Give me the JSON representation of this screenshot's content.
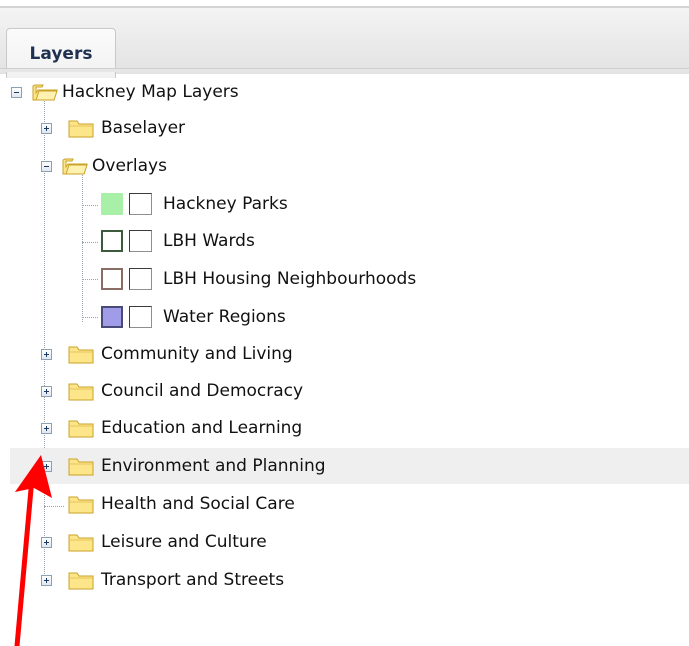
{
  "top_caption": "",
  "tabs": [
    {
      "label": "Layers"
    }
  ],
  "tree": {
    "root": {
      "label": "Hackney Map Layers",
      "expanded": true
    },
    "items": [
      {
        "label": "Baselayer",
        "expanded": false
      },
      {
        "label": "Overlays",
        "expanded": true,
        "children": [
          {
            "label": "Hackney Parks",
            "swatch": {
              "fill": "#a8f0a8",
              "border": "#a8f0a8"
            }
          },
          {
            "label": "LBH Wards",
            "swatch": {
              "fill": "#ffffff",
              "border": "#3d5a3d"
            }
          },
          {
            "label": "LBH Housing Neighbourhoods",
            "swatch": {
              "fill": "#ffffff",
              "border": "#8a6e66"
            }
          },
          {
            "label": "Water Regions",
            "swatch": {
              "fill": "#a09ce8",
              "border": "#4a4a78"
            }
          }
        ]
      },
      {
        "label": "Community and Living",
        "expanded": false
      },
      {
        "label": "Council and Democracy",
        "expanded": false
      },
      {
        "label": "Education and Learning",
        "expanded": false
      },
      {
        "label": "Environment and Planning",
        "expanded": false,
        "highlighted": true
      },
      {
        "label": "Health and Social Care",
        "expanded": false
      },
      {
        "label": "Leisure and Culture",
        "expanded": false
      },
      {
        "label": "Transport and Streets",
        "expanded": false
      }
    ]
  },
  "colors": {
    "annotation_arrow": "#ff0000",
    "folder_fill": "#fde68a",
    "folder_border": "#c9a227",
    "tree_lines": "#9aa3ad",
    "tab_text": "#1f3050",
    "hover_row": "#efefef"
  },
  "icons": {
    "expanded_toggle": "minus-box-icon",
    "collapsed_toggle": "plus-box-icon",
    "folder": "folder-icon",
    "annotation": "red-arrow"
  }
}
